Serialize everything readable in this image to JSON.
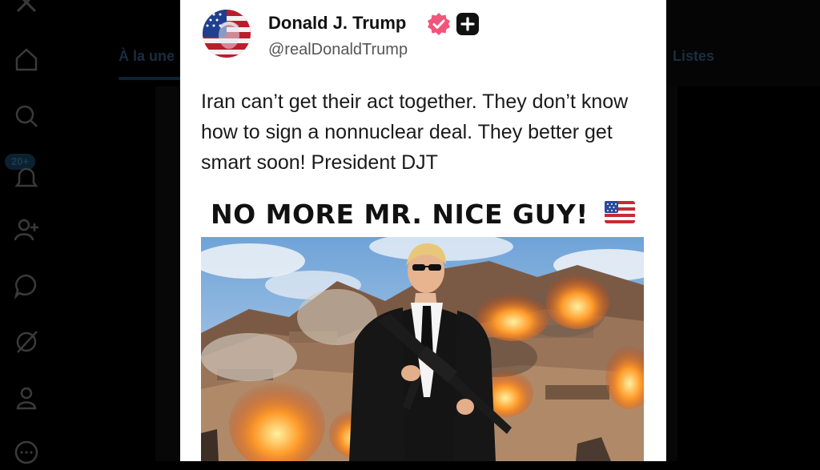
{
  "background": {
    "tab_left_label": "À la une",
    "tab_right_label": "Listes",
    "notification_count": "20+",
    "nav_icons": [
      "x-logo-icon",
      "home-icon",
      "search-icon",
      "bell-icon",
      "add-user-icon",
      "chat-icon",
      "slash-circle-icon",
      "profile-icon",
      "more-icon"
    ]
  },
  "post": {
    "display_name": "Donald J. Trump",
    "handle": "@realDonaldTrump",
    "text": "Iran can’t get their act together. They don’t know how to sign a nonnuclear deal. They better get smart soon! President DJT",
    "image_headline": "NO MORE MR. NICE GUY!",
    "verified_color": "#f2557a",
    "accent_colors": {
      "card": "#ffffff",
      "text": "#1a1a1a",
      "muted": "#555555"
    }
  }
}
